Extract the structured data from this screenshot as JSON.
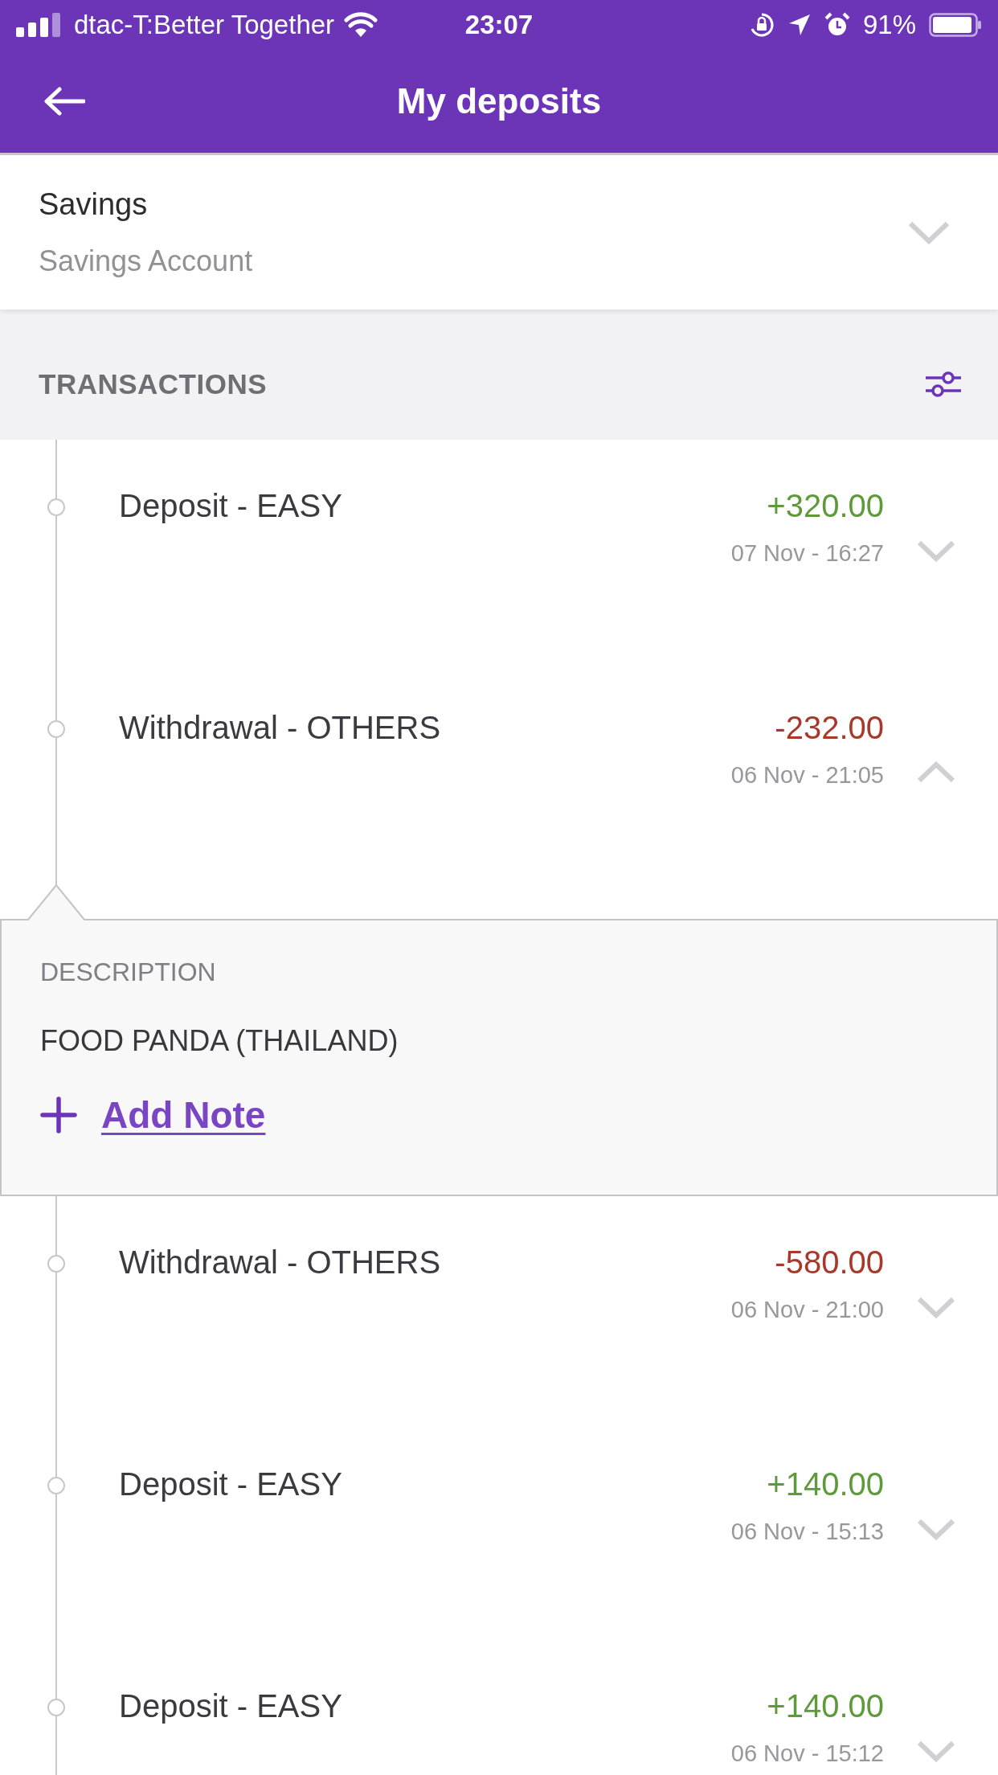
{
  "status_bar": {
    "carrier": "dtac-T:Better Together",
    "time": "23:07",
    "battery": "91%"
  },
  "header": {
    "title": "My deposits"
  },
  "account": {
    "name": "Savings",
    "type": "Savings Account",
    "expanded": false
  },
  "section": {
    "title": "TRANSACTIONS"
  },
  "transactions": [
    {
      "title": "Deposit - EASY",
      "amount": "+320.00",
      "kind": "credit",
      "date": "07 Nov - 16:27",
      "expanded": false
    },
    {
      "title": "Withdrawal - OTHERS",
      "amount": "-232.00",
      "kind": "debit",
      "date": "06 Nov - 21:05",
      "expanded": true,
      "details": {
        "label": "DESCRIPTION",
        "value": "FOOD PANDA (THAILAND)",
        "add_note": "Add Note"
      }
    },
    {
      "title": "Withdrawal - OTHERS",
      "amount": "-580.00",
      "kind": "debit",
      "date": "06 Nov - 21:00",
      "expanded": false
    },
    {
      "title": "Deposit - EASY",
      "amount": "+140.00",
      "kind": "credit",
      "date": "06 Nov - 15:13",
      "expanded": false
    },
    {
      "title": "Deposit - EASY",
      "amount": "+140.00",
      "kind": "credit",
      "date": "06 Nov - 15:12",
      "expanded": false
    }
  ]
}
